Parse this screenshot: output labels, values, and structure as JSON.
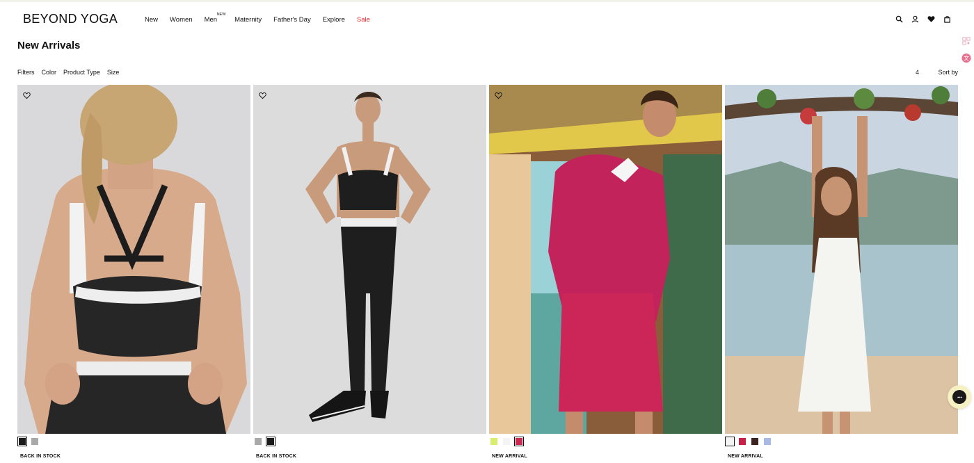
{
  "brand": {
    "logo": "BEYOND YOGA"
  },
  "nav": {
    "items": [
      {
        "label": "New"
      },
      {
        "label": "Women"
      },
      {
        "label": "Men",
        "badge": "NEW"
      },
      {
        "label": "Maternity"
      },
      {
        "label": "Father's Day"
      },
      {
        "label": "Explore"
      },
      {
        "label": "Sale"
      }
    ],
    "sale_color": "#e8262d"
  },
  "header_icons": [
    "search-icon",
    "account-icon",
    "wishlist-heart-icon",
    "bag-icon"
  ],
  "page": {
    "title": "New Arrivals"
  },
  "filters": {
    "items": [
      "Filters",
      "Color",
      "Product Type",
      "Size"
    ],
    "count": "4",
    "sort_label": "Sort by"
  },
  "products": [
    {
      "badge": "BACK IN STOCK",
      "image": "back view of woman in black strappy sports bra and leggings",
      "swatches": [
        {
          "color": "#1a1a1a",
          "selected": true
        },
        {
          "color": "#a9a9a9",
          "selected": false
        }
      ]
    },
    {
      "badge": "BACK IN STOCK",
      "image": "woman in black sports bra and black leggings with white waistband",
      "swatches": [
        {
          "color": "#a9a9a9",
          "selected": false
        },
        {
          "color": "#1a1a1a",
          "selected": true
        }
      ]
    },
    {
      "badge": "NEW ARRIVAL",
      "image": "woman in pink half-zip jacket and pink pleated skort",
      "swatches": [
        {
          "color": "#d9ee6f",
          "selected": false
        },
        {
          "color": "#f4f4f4",
          "selected": false
        },
        {
          "color": "#cc2a52",
          "selected": true
        }
      ]
    },
    {
      "badge": "NEW ARRIVAL",
      "image": "woman in white mini dress on a beach under a tree",
      "swatches": [
        {
          "color": "#f4f4f4",
          "selected": true
        },
        {
          "color": "#c62146",
          "selected": false
        },
        {
          "color": "#3b2320",
          "selected": false
        },
        {
          "color": "#a9b9e6",
          "selected": false
        }
      ]
    }
  ]
}
